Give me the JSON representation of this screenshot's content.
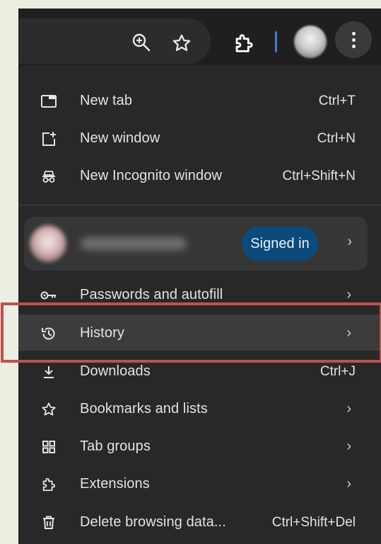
{
  "toolbar": {
    "icons": [
      "zoom-in-icon",
      "star-icon",
      "extensions-icon",
      "avatar",
      "more-icon"
    ],
    "accent": "#4a7bd0"
  },
  "menu": {
    "items": [
      {
        "label": "New tab",
        "shortcut": "Ctrl+T",
        "icon": "new-tab-icon"
      },
      {
        "label": "New window",
        "shortcut": "Ctrl+N",
        "icon": "new-window-icon"
      },
      {
        "label": "New Incognito window",
        "shortcut": "Ctrl+Shift+N",
        "icon": "incognito-icon"
      }
    ],
    "profile": {
      "status": "Signed in",
      "status_color": "#0b4a7a"
    },
    "items2": [
      {
        "label": "Passwords and autofill",
        "icon": "key-icon"
      },
      {
        "label": "History",
        "icon": "history-icon",
        "highlighted": true
      },
      {
        "label": "Downloads",
        "shortcut": "Ctrl+J",
        "icon": "download-icon"
      },
      {
        "label": "Bookmarks and lists",
        "icon": "star-icon"
      },
      {
        "label": "Tab groups",
        "icon": "tab-groups-icon"
      },
      {
        "label": "Extensions",
        "icon": "extensions-icon"
      },
      {
        "label": "Delete browsing data...",
        "shortcut": "Ctrl+Shift+Del",
        "icon": "trash-icon"
      }
    ]
  },
  "annotation": {
    "highlight_color": "#c0504d"
  }
}
